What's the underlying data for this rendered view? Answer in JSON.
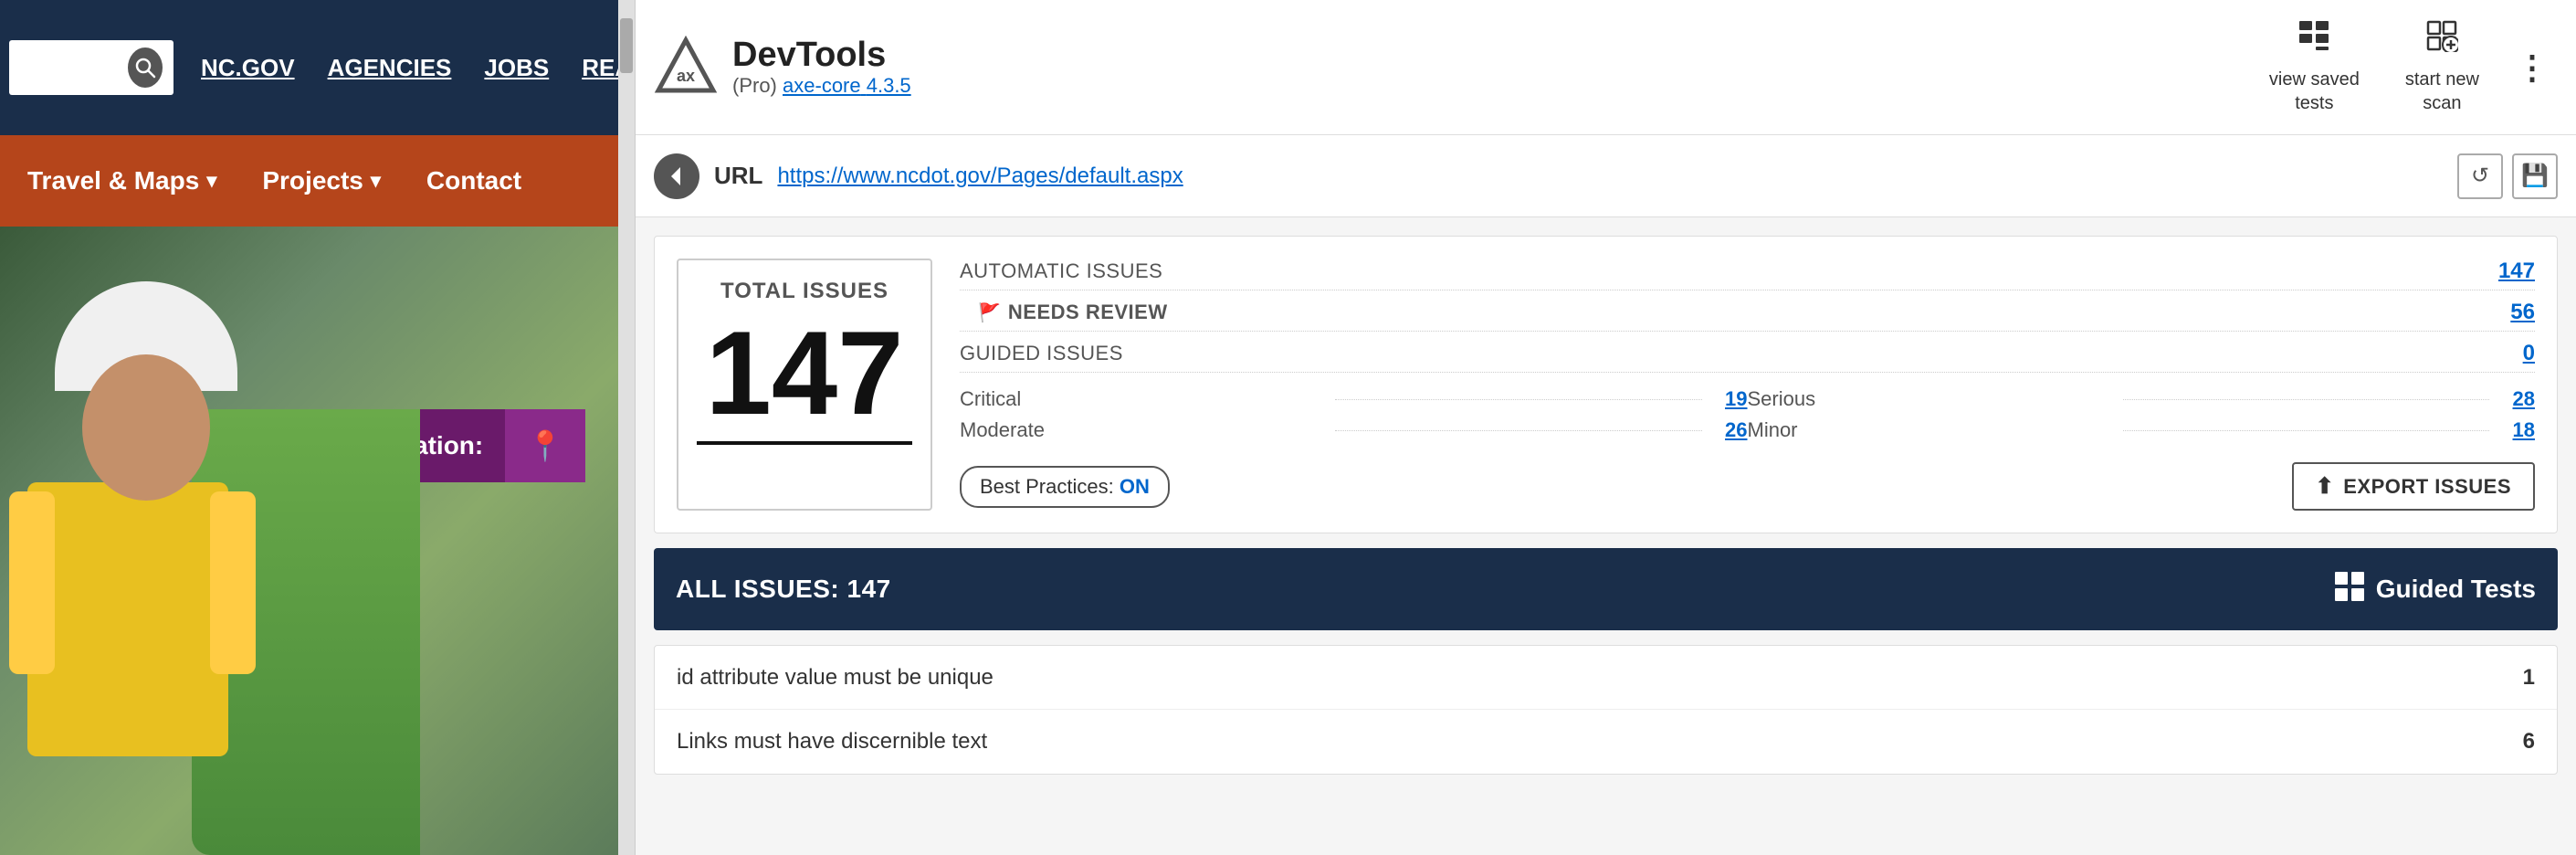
{
  "website": {
    "nav_top": {
      "links": [
        "NC.GOV",
        "AGENCIES",
        "JOBS",
        "REAL TIME TRAFFIC"
      ],
      "search_placeholder": ""
    },
    "nav_orange": {
      "items": [
        {
          "label": "Travel & Maps",
          "has_chevron": true
        },
        {
          "label": "Projects",
          "has_chevron": true
        },
        {
          "label": "Contact",
          "has_chevron": false
        }
      ]
    },
    "hero": {
      "location_prompt": "Select Your Location:"
    }
  },
  "devtools": {
    "header": {
      "app_name": "DevTools",
      "pro_label": "(Pro)",
      "axe_core_label": "axe-core",
      "version": "4.3.5",
      "view_saved_label": "view saved\ntests",
      "start_new_label": "start new\nscan",
      "more_icon": "⋮"
    },
    "url_bar": {
      "label": "URL",
      "value": "https://www.ncdot.gov/Pages/default.aspx"
    },
    "issues_summary": {
      "total_label": "TOTAL ISSUES",
      "total_count": "147",
      "automatic_label": "AUTOMATIC ISSUES",
      "automatic_count": "147",
      "needs_review_label": "NEEDS REVIEW",
      "needs_review_count": "56",
      "guided_label": "GUIDED ISSUES",
      "guided_count": "0",
      "critical_label": "Critical",
      "critical_count": "19",
      "serious_label": "Serious",
      "serious_count": "28",
      "moderate_label": "Moderate",
      "moderate_count": "26",
      "minor_label": "Minor",
      "minor_count": "18"
    },
    "best_practices": {
      "label": "Best Practices:",
      "status": "ON"
    },
    "export_btn": {
      "label": "EXPORT ISSUES"
    },
    "all_issues": {
      "title": "ALL ISSUES:",
      "count": "147",
      "guided_tests_label": "Guided Tests"
    },
    "issue_rows": [
      {
        "name": "id attribute value must be unique",
        "count": "1"
      },
      {
        "name": "Links must have discernible text",
        "count": "6"
      }
    ]
  }
}
